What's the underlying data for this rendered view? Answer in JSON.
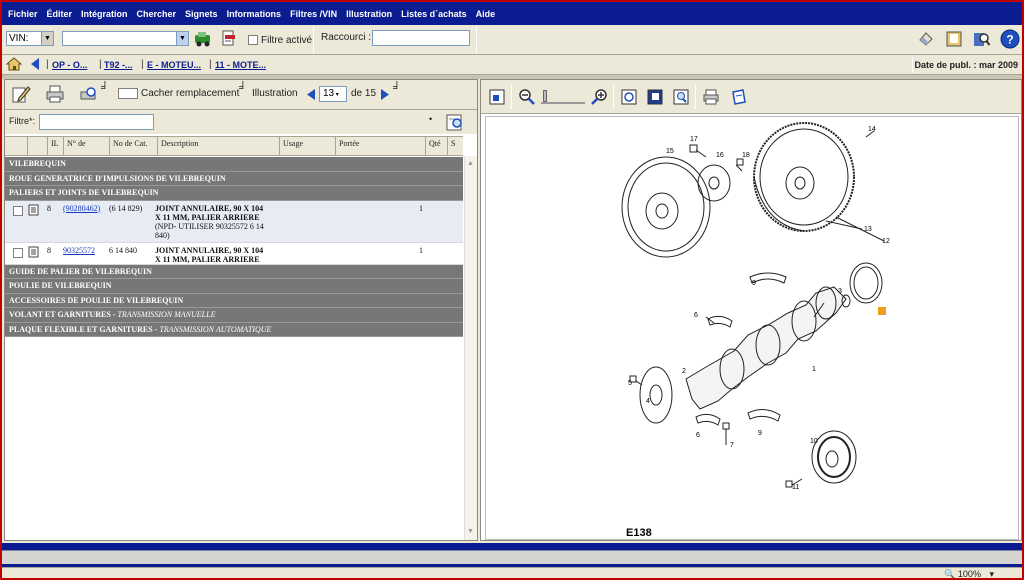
{
  "menu": [
    "Fichier",
    "Éditer",
    "Intégration",
    "Chercher",
    "Signets",
    "Informations",
    "Filtres /VIN",
    "Illustration",
    "Listes d´achats",
    "Aide"
  ],
  "toolbar": {
    "vin_label": "VIN:",
    "filtre_label": "Filtre activé",
    "raccourci_label": "Raccourci :"
  },
  "breadcrumb": {
    "items": [
      "OP - O...",
      "T92 -...",
      "E - MOTEU...",
      "11 - MOTE..."
    ],
    "pub_date": "Date de publ. : mar 2009"
  },
  "left_toolbar": {
    "cacher_label": "Cacher remplacement",
    "illustration_label": "Illustration",
    "page_value": "13",
    "page_total": "de 15"
  },
  "filter": {
    "label": "Filtre*:"
  },
  "columns": [
    "IL",
    "N° de",
    "No de Cat.",
    "Description",
    "Usage",
    "Portée",
    "Qté",
    "S"
  ],
  "sections_top": [
    "VILEBREQUIN",
    "ROUE GENERATRICE D'IMPULSIONS DE VILEBREQUIN",
    "PALIERS ET JOINTS DE VILEBREQUIN"
  ],
  "parts": [
    {
      "il": "8",
      "part_no": "(90280462)",
      "cat_no": "(6 14 829)",
      "desc": [
        "JOINT ANNULAIRE, 90 X 104",
        "X 11 MM, PALIER ARRIERE",
        "(NPD- UTILISER 90325572 6 14",
        "840)"
      ],
      "qty": "1"
    },
    {
      "il": "8",
      "part_no": "90325572",
      "cat_no": "6 14 840",
      "desc": [
        "JOINT ANNULAIRE, 90 X 104",
        "X 11 MM, PALIER ARRIERE"
      ],
      "qty": "1"
    }
  ],
  "sections_bottom": [
    {
      "title": "GUIDE DE PALIER DE VILEBREQUIN",
      "sub": ""
    },
    {
      "title": "POULIE DE VILEBREQUIN",
      "sub": ""
    },
    {
      "title": "ACCESSOIRES DE POULIE DE VILEBREQUIN",
      "sub": ""
    },
    {
      "title": "VOLANT ET GARNITURES - ",
      "sub": "TRANSMISSION MANUELLE"
    },
    {
      "title": "PLAQUE FLEXIBLE ET GARNITURES - ",
      "sub": "TRANSMISSION AUTOMATIQUE"
    }
  ],
  "diagram": {
    "figure_label": "E138",
    "callouts": [
      "17",
      "16",
      "18",
      "15",
      "14",
      "13",
      "12",
      "9",
      "3",
      "6",
      "2",
      "1",
      "5",
      "4",
      "6",
      "7",
      "9",
      "10",
      "11"
    ]
  },
  "status": {
    "zoom": "100%"
  },
  "colors": {
    "menu_bg": "#0a1c8f",
    "section_bg": "#777777",
    "link": "#1a3bbf",
    "frame": "#c00000"
  }
}
